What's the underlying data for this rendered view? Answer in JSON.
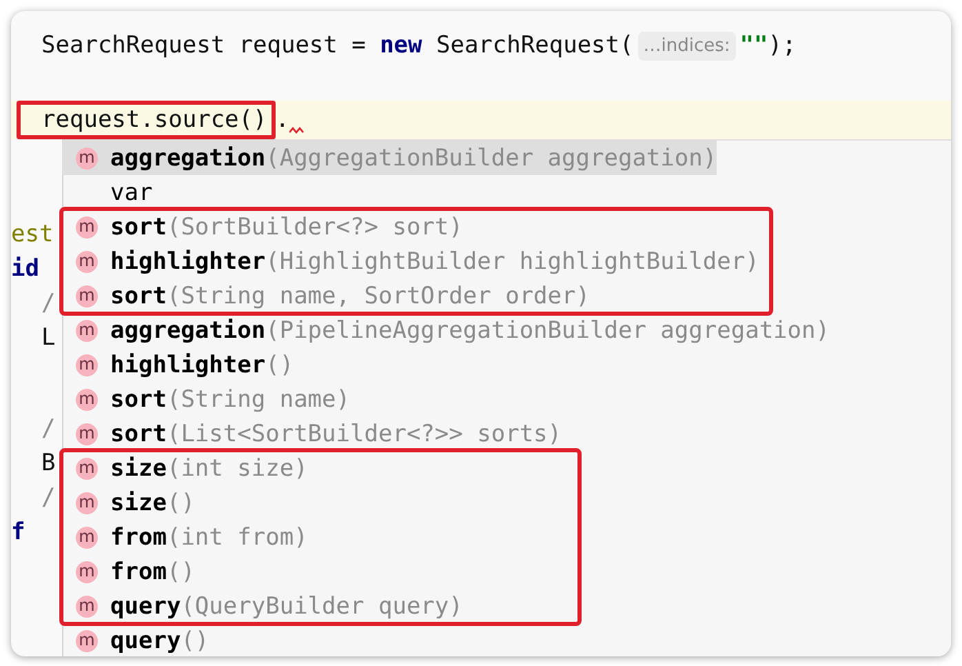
{
  "editor": {
    "line_1": {
      "type_name": "SearchRequest",
      "variable": "request =",
      "keyword": "new",
      "constructor": "SearchRequest(",
      "hint": "…indices:",
      "string": "\"\"",
      "end": ");"
    },
    "current_line": {
      "expression": "request.source()",
      "dot": ".",
      "boxed": true,
      "error": true
    },
    "background_code": [
      {
        "kind": "annotation",
        "text": "est"
      },
      {
        "kind": "keyword",
        "text": "id"
      },
      {
        "kind": "comment",
        "text": "/"
      },
      {
        "kind": "plain",
        "text": "L"
      },
      {
        "kind": "comment",
        "text": "/"
      },
      {
        "kind": "plain",
        "text": "B"
      },
      {
        "kind": "comment",
        "text": "/"
      },
      {
        "kind": "keyword",
        "text": "f"
      }
    ]
  },
  "completion_popup": {
    "groups": [
      {
        "boxed": false,
        "items": [
          {
            "kind": "method",
            "icon": "m",
            "name": "aggregation",
            "params": "(AggregationBuilder aggregation)",
            "selected": true
          },
          {
            "kind": "template",
            "name": "var",
            "selected": false
          }
        ]
      },
      {
        "boxed": true,
        "items": [
          {
            "kind": "method",
            "icon": "m",
            "name": "sort",
            "params": "(SortBuilder<?> sort)",
            "selected": false
          },
          {
            "kind": "method",
            "icon": "m",
            "name": "highlighter",
            "params": "(HighlightBuilder highlightBuilder)",
            "selected": false
          },
          {
            "kind": "method",
            "icon": "m",
            "name": "sort",
            "params": "(String name, SortOrder order)",
            "selected": false
          }
        ]
      },
      {
        "boxed": false,
        "items": [
          {
            "kind": "method",
            "icon": "m",
            "name": "aggregation",
            "params": "(PipelineAggregationBuilder aggregation)",
            "selected": false
          },
          {
            "kind": "method",
            "icon": "m",
            "name": "highlighter",
            "params": "()",
            "selected": false
          },
          {
            "kind": "method",
            "icon": "m",
            "name": "sort",
            "params": "(String name)",
            "selected": false
          },
          {
            "kind": "method",
            "icon": "m",
            "name": "sort",
            "params": "(List<SortBuilder<?>> sorts)",
            "selected": false
          }
        ]
      },
      {
        "boxed": true,
        "items": [
          {
            "kind": "method",
            "icon": "m",
            "name": "size",
            "params": "(int size)",
            "selected": false
          },
          {
            "kind": "method",
            "icon": "m",
            "name": "size",
            "params": "()",
            "selected": false
          },
          {
            "kind": "method",
            "icon": "m",
            "name": "from",
            "params": "(int from)",
            "selected": false
          },
          {
            "kind": "method",
            "icon": "m",
            "name": "from",
            "params": "()",
            "selected": false
          },
          {
            "kind": "method",
            "icon": "m",
            "name": "query",
            "params": "(QueryBuilder query)",
            "selected": false
          }
        ]
      },
      {
        "boxed": false,
        "items": [
          {
            "kind": "method",
            "icon": "m",
            "name": "query",
            "params": "()",
            "selected": false
          }
        ]
      }
    ]
  }
}
